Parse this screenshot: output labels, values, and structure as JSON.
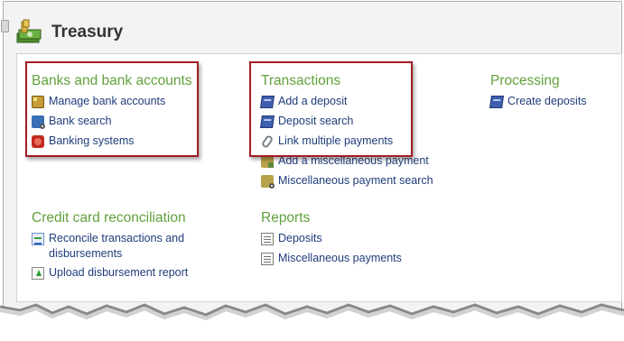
{
  "header": {
    "title": "Treasury",
    "icon": "treasury-money-icon"
  },
  "sections": {
    "banks": {
      "title": "Banks and bank accounts",
      "items": [
        {
          "label": "Manage bank accounts",
          "icon": "bank-icon"
        },
        {
          "label": "Bank search",
          "icon": "bank-search-icon"
        },
        {
          "label": "Banking systems",
          "icon": "banking-system-icon"
        }
      ]
    },
    "transactions": {
      "title": "Transactions",
      "items": [
        {
          "label": "Add a deposit",
          "icon": "deposit-icon"
        },
        {
          "label": "Deposit search",
          "icon": "deposit-search-icon"
        },
        {
          "label": "Link multiple payments",
          "icon": "paperclip-icon"
        },
        {
          "label": "Add a miscellaneous payment",
          "icon": "misc-payment-icon"
        },
        {
          "label": "Miscellaneous payment search",
          "icon": "misc-payment-search-icon"
        }
      ]
    },
    "processing": {
      "title": "Processing",
      "items": [
        {
          "label": "Create deposits",
          "icon": "deposit-icon"
        }
      ]
    },
    "credit": {
      "title": "Credit card reconciliation",
      "items": [
        {
          "label": "Reconcile transactions and disbursements",
          "icon": "reconcile-icon"
        },
        {
          "label": "Upload disbursement report",
          "icon": "upload-icon"
        }
      ]
    },
    "reports": {
      "title": "Reports",
      "items": [
        {
          "label": "Deposits",
          "icon": "report-icon"
        },
        {
          "label": "Miscellaneous payments",
          "icon": "report-icon"
        }
      ]
    }
  },
  "colors": {
    "section_title": "#62a13c",
    "link": "#1f3c7a",
    "highlight_box": "#a41c23"
  }
}
